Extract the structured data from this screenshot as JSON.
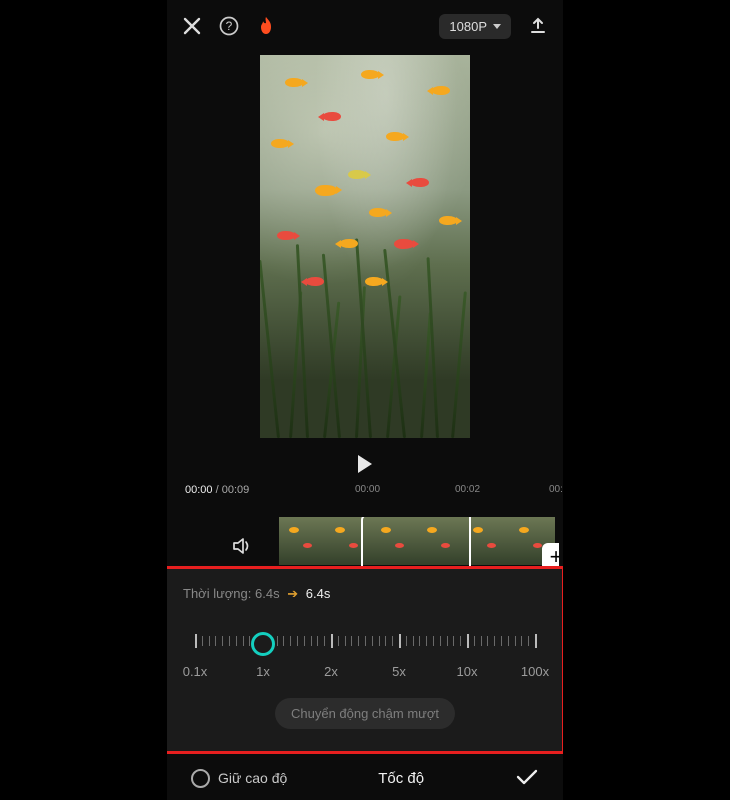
{
  "topbar": {
    "resolution_label": "1080P"
  },
  "timeline": {
    "current": "00:00",
    "total": "00:09",
    "ticks": [
      "00:00",
      "00:02",
      "00:"
    ]
  },
  "speed": {
    "duration_label": "Thời lượng:",
    "duration_before": "6.4s",
    "duration_after": "6.4s",
    "scale_labels": [
      "0.1x",
      "1x",
      "2x",
      "5x",
      "10x",
      "100x"
    ],
    "smooth_label": "Chuyển động chậm mượt"
  },
  "bottom": {
    "keep_pitch": "Giữ cao độ",
    "title": "Tốc độ"
  }
}
